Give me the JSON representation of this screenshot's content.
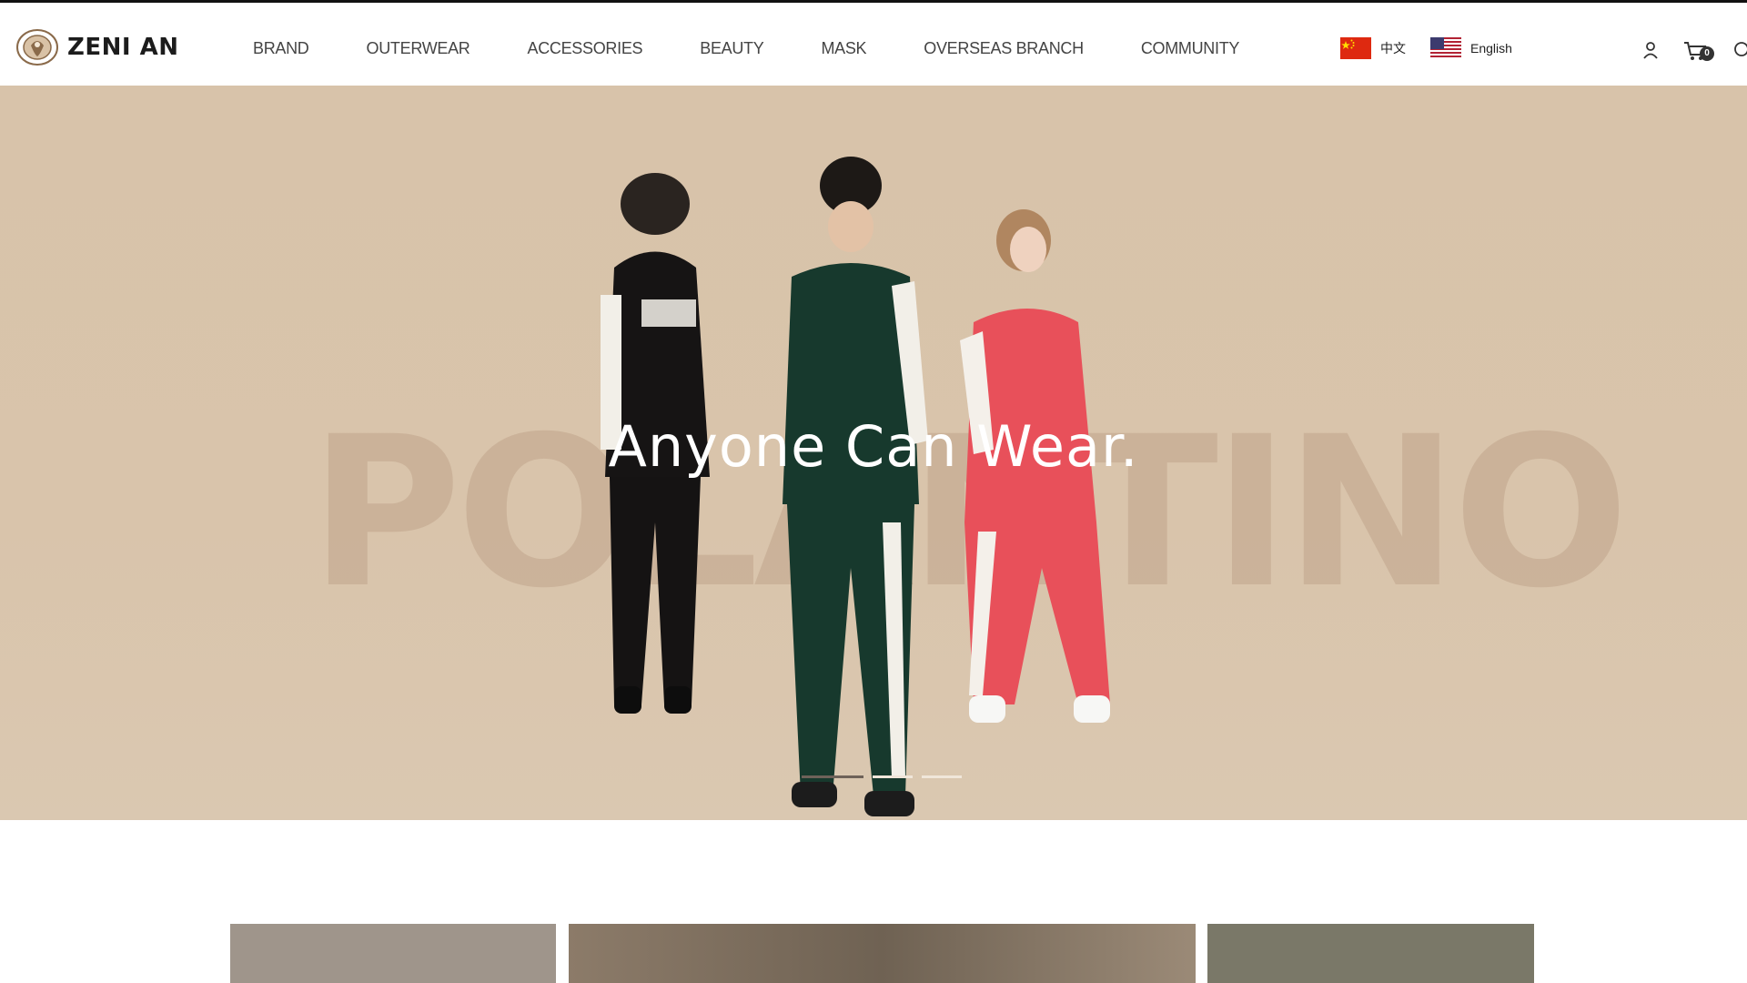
{
  "brand": {
    "name": "ZENI AN",
    "logo_icon": "crest-emblem-icon"
  },
  "nav": {
    "items": [
      {
        "label": "BRAND"
      },
      {
        "label": "OUTERWEAR"
      },
      {
        "label": "ACCESSORIES"
      },
      {
        "label": "BEAUTY"
      },
      {
        "label": "MASK"
      },
      {
        "label": "OVERSEAS BRANCH"
      },
      {
        "label": "COMMUNITY"
      }
    ]
  },
  "languages": [
    {
      "label": "中文",
      "icon": "china-flag-icon"
    },
    {
      "label": "English",
      "icon": "us-flag-icon"
    }
  ],
  "header_icons": {
    "account": "user-icon",
    "cart": "cart-icon",
    "cart_count": "0",
    "search": "search-icon"
  },
  "hero": {
    "watermark": "POLANTINO",
    "title": "Anyone Can Wear.",
    "slides_total": 3,
    "active_slide": 1,
    "background_color": "#d8c3aa"
  },
  "cards": {
    "colors": [
      "#9f958b",
      "#7a6a5a",
      "#7a7868"
    ]
  }
}
